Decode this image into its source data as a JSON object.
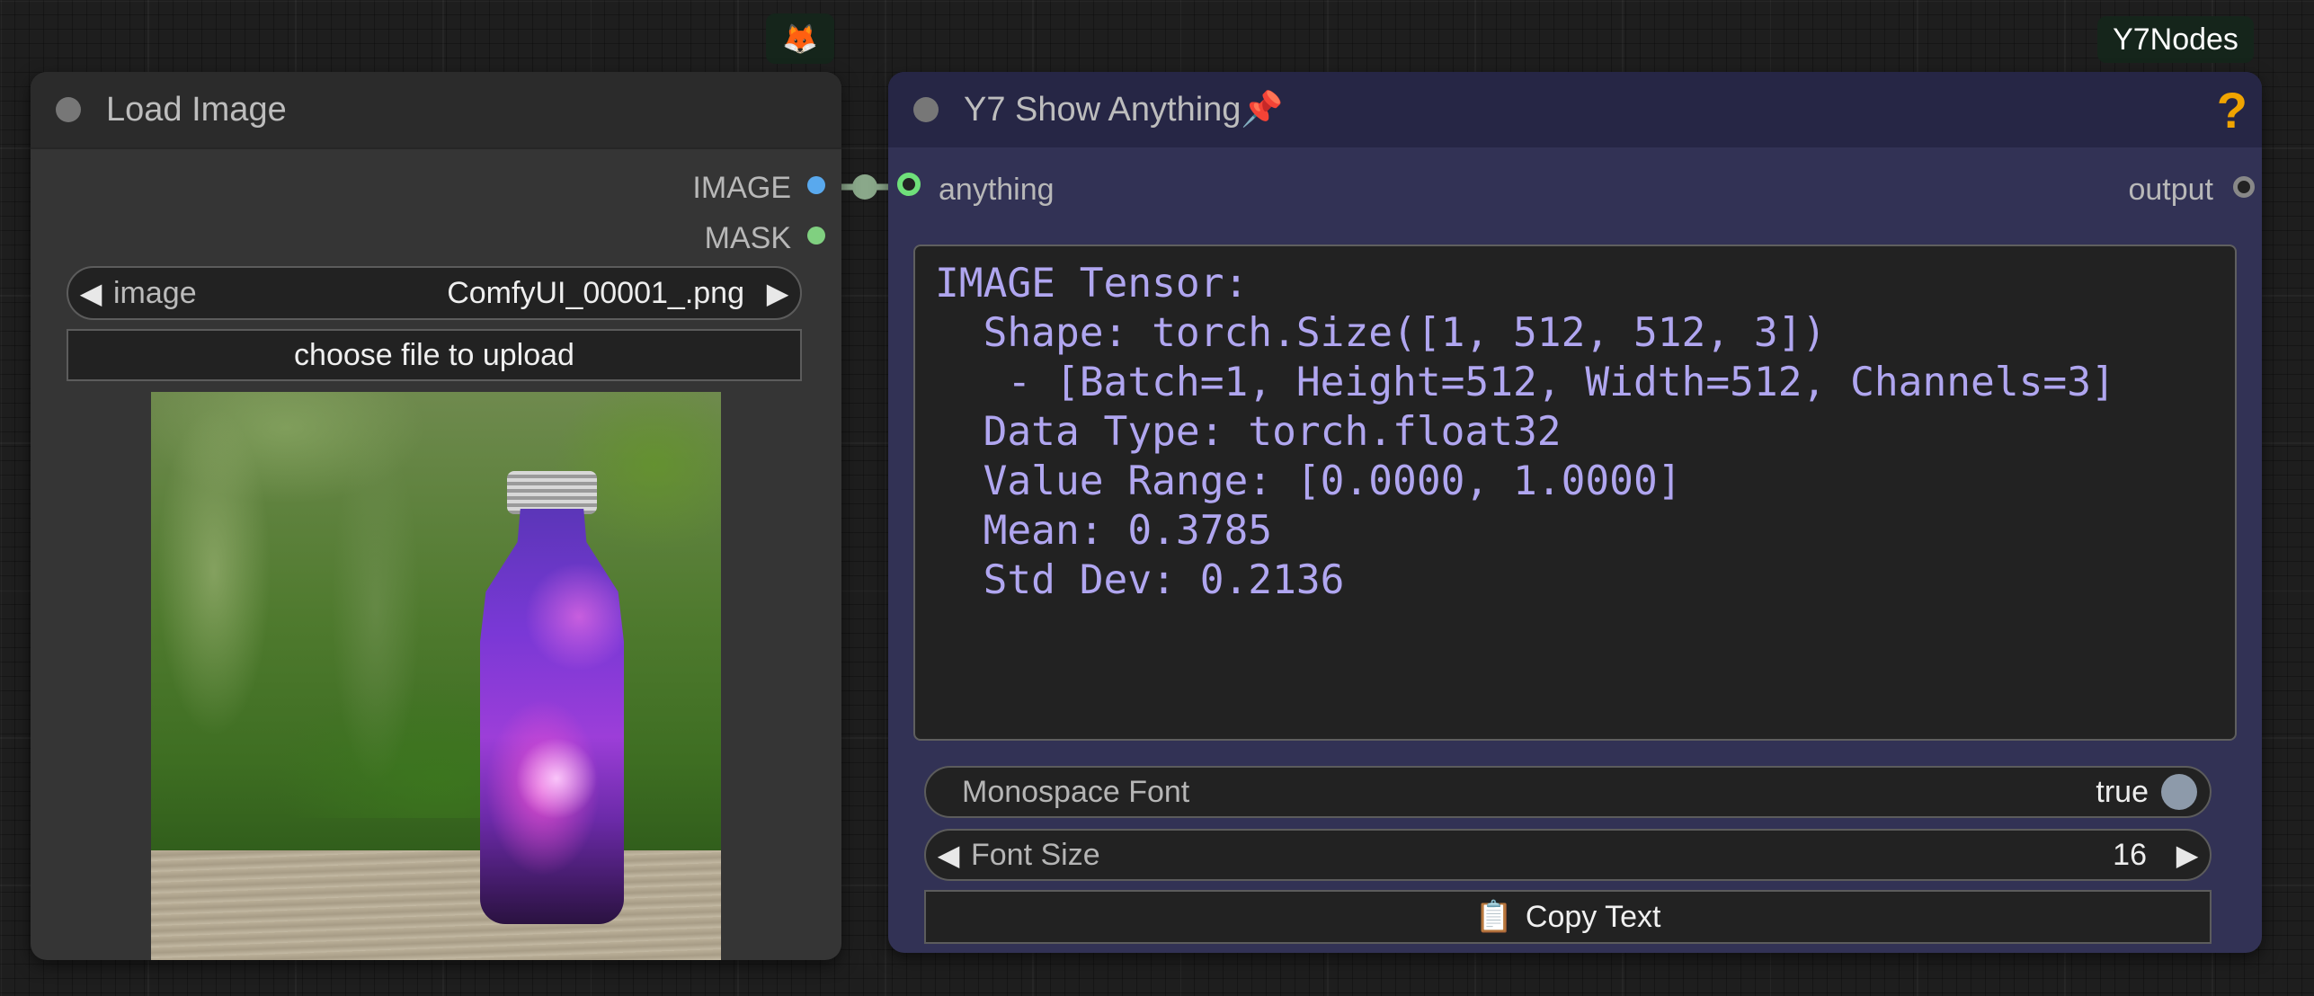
{
  "badges": {
    "fox_icon": "🦊",
    "y7nodes_label": "Y7Nodes"
  },
  "load_image_node": {
    "title": "Load Image",
    "outputs": [
      {
        "label": "IMAGE",
        "color": "#59a9ee"
      },
      {
        "label": "MASK",
        "color": "#80d080"
      }
    ],
    "image_widget": {
      "label": "image",
      "value": "ComfyUI_00001_.png"
    },
    "upload_button_label": "choose file to upload"
  },
  "show_anything_node": {
    "title": "Y7 Show Anything📌",
    "help_icon": "?",
    "input_label": "anything",
    "output_label": "output",
    "display_text": "IMAGE Tensor:\n  Shape: torch.Size([1, 512, 512, 3])\n   - [Batch=1, Height=512, Width=512, Channels=3]\n  Data Type: torch.float32\n  Value Range: [0.0000, 1.0000]\n  Mean: 0.3785\n  Std Dev: 0.2136",
    "monospace_widget": {
      "label": "Monospace Font",
      "value": "true"
    },
    "font_size_widget": {
      "label": "Font Size",
      "value": "16"
    },
    "copy_button": {
      "icon": "📋",
      "label": "Copy Text"
    }
  },
  "colors": {
    "image_slot": "#59a9ee",
    "mask_slot": "#80d080",
    "text_color": "#b0a6f0",
    "help_color": "#f0a400"
  }
}
